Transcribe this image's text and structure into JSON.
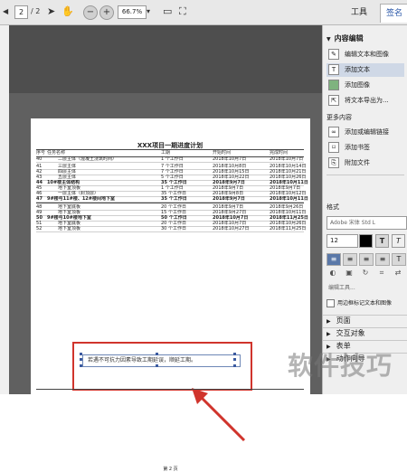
{
  "toolbar": {
    "page_current": "2",
    "page_total": "/ 2",
    "zoom": "66.7%",
    "tab_tools": "工具",
    "tab_sign": "签名"
  },
  "document": {
    "sheet_title": "XXX项目一期进度计划",
    "headers": [
      "序号",
      "任务名称",
      "工期",
      "开始时间",
      "完成时间"
    ],
    "rows": [
      {
        "id": "40",
        "name": "二层主体（混凝土浇筑时间）",
        "dur": "1 个工作日",
        "start": "2018年10月7日",
        "end": "2018年10月7日",
        "bold": false
      },
      {
        "id": "41",
        "name": "三层主体",
        "dur": "7 个工作日",
        "start": "2018年10月8日",
        "end": "2018年10月14日",
        "bold": false
      },
      {
        "id": "42",
        "name": "四层主体",
        "dur": "7 个工作日",
        "start": "2018年10月15日",
        "end": "2018年10月21日",
        "bold": false
      },
      {
        "id": "43",
        "name": "五层主体",
        "dur": "5 个工作日",
        "start": "2018年10月22日",
        "end": "2018年10月26日",
        "bold": false
      },
      {
        "id": "44",
        "name": "10#楼主体结构",
        "dur": "35 个工作日",
        "start": "2018年9月7日",
        "end": "2018年10月11日",
        "bold": true
      },
      {
        "id": "45",
        "name": "地下室顶板",
        "dur": "1 个工作日",
        "start": "2018年9月7日",
        "end": "2018年9月7日",
        "bold": false
      },
      {
        "id": "46",
        "name": "一层主体（封顶层）",
        "dur": "35 个工作日",
        "start": "2018年9月8日",
        "end": "2018年10月12日",
        "bold": false
      },
      {
        "id": "47",
        "name": "9#楼与11#楼、12#楼间地下室",
        "dur": "35 个工作日",
        "start": "2018年9月7日",
        "end": "2018年10月11日",
        "bold": true
      },
      {
        "id": "48",
        "name": "地下室底板",
        "dur": "20 个工作日",
        "start": "2018年9月7日",
        "end": "2018年9月26日",
        "bold": false
      },
      {
        "id": "49",
        "name": "地下室顶板",
        "dur": "15 个工作日",
        "start": "2018年9月27日",
        "end": "2018年10月11日",
        "bold": false
      },
      {
        "id": "50",
        "name": "9#楼与10#楼地下室",
        "dur": "50 个工作日",
        "start": "2018年10月7日",
        "end": "2018年11月25日",
        "bold": true
      },
      {
        "id": "51",
        "name": "地下室底板",
        "dur": "20 个工作日",
        "start": "2018年10月7日",
        "end": "2018年10月26日",
        "bold": false
      },
      {
        "id": "52",
        "name": "地下室顶板",
        "dur": "30 个工作日",
        "start": "2018年10月27日",
        "end": "2018年11月25日",
        "bold": false
      }
    ],
    "annotation_text": "若遇不可抗力因素导致工期延误，顺延工期。",
    "page_number": "第 2 页"
  },
  "panel": {
    "content_edit_title": "内容编辑",
    "items": [
      {
        "icon": "edit-icon",
        "label": "编辑文本和图像"
      },
      {
        "icon": "add-text-icon",
        "label": "添加文本"
      },
      {
        "icon": "image-icon",
        "label": "添加图像"
      },
      {
        "icon": "export-icon",
        "label": "将文本导出为..."
      }
    ],
    "more_content_title": "更多内容",
    "more_items": [
      {
        "icon": "link-icon",
        "label": "添加或编辑链接"
      },
      {
        "icon": "bookmark-icon",
        "label": "添加书签"
      },
      {
        "icon": "attach-icon",
        "label": "附加文件"
      }
    ],
    "format_title": "格式",
    "font_placeholder": "Adobe 宋体 Std L",
    "font_size": "12",
    "edit_tools_label": "编辑工具...",
    "checkbox_label": "用边框标记文本和图像",
    "collapsed_sections": [
      "页面",
      "交互对象",
      "表单",
      "动作向导"
    ]
  },
  "watermark": "软件技巧",
  "colors": {
    "highlight_red": "#d0342c",
    "selected_item_bg": "#cfd8e6",
    "accent_blue": "#2a57a8"
  }
}
